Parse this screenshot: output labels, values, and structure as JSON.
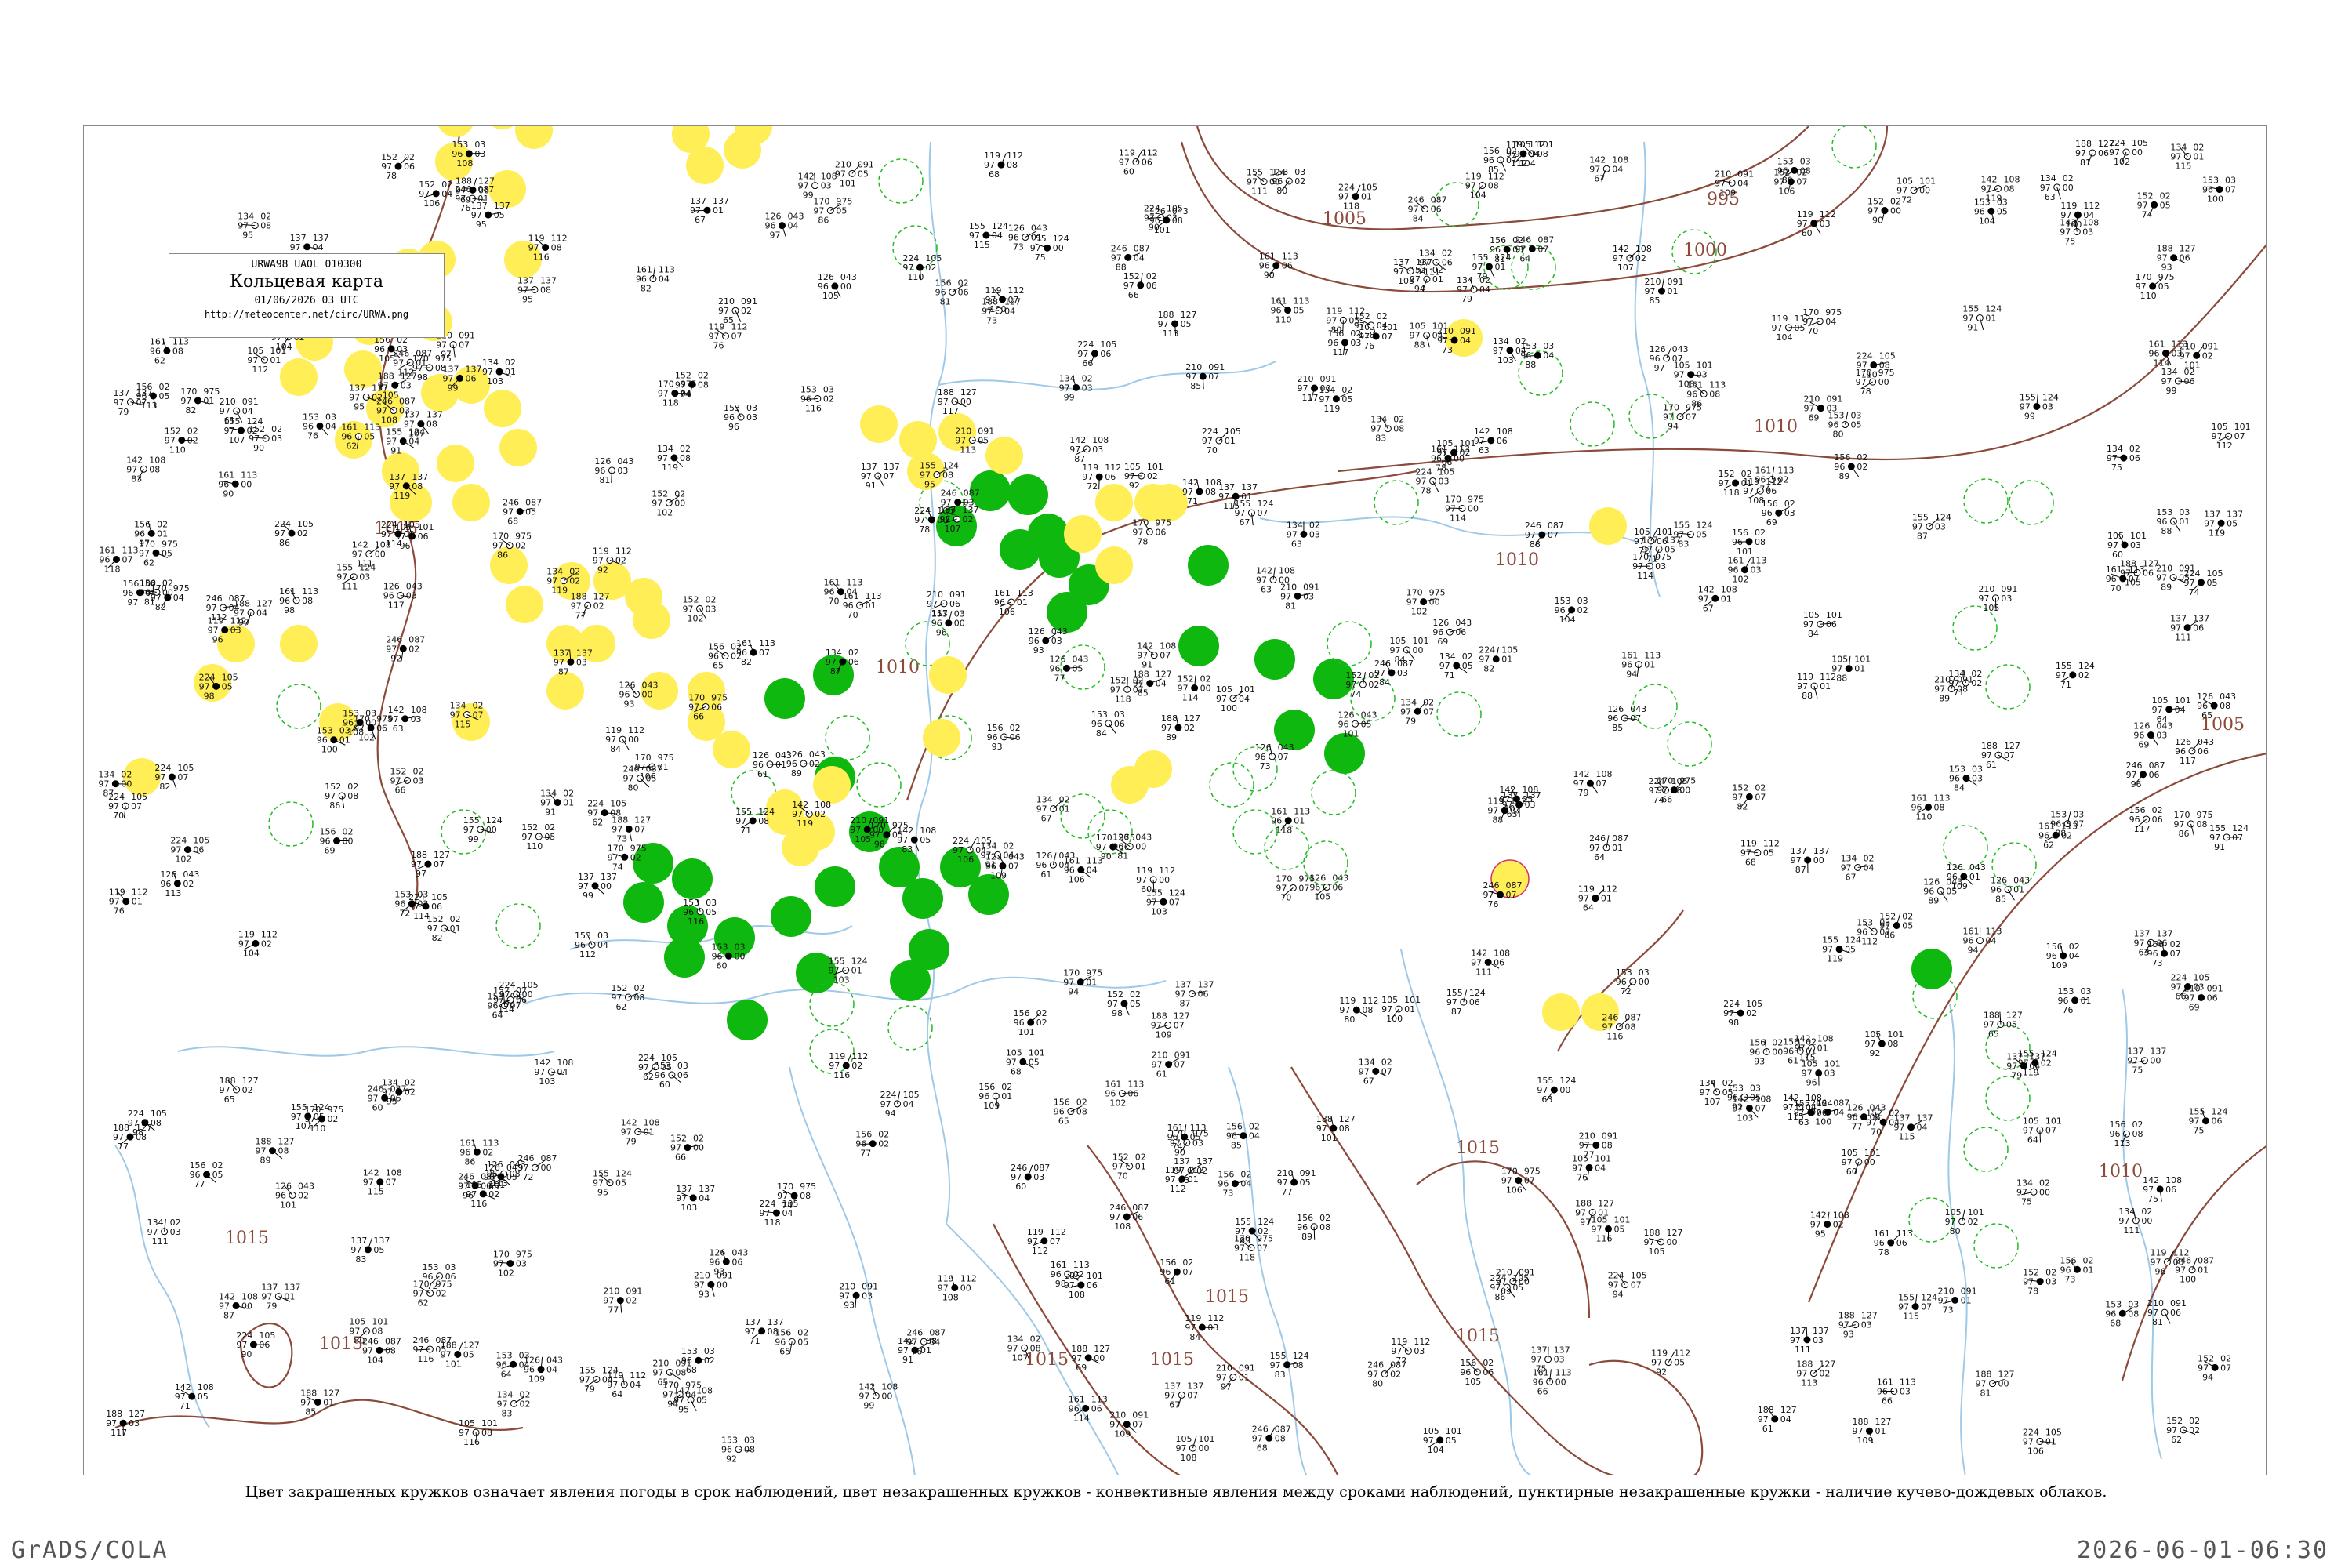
{
  "header": {
    "code_line": "URWA98  UAOL  010300",
    "title": "Кольцевая карта",
    "date_line": "01/06/2026 03 UTC",
    "url": "http://meteocenter.net/circ/URWA.png"
  },
  "caption": "Цвет закрашенных кружков означает явления погоды в срок наблюдений, цвет незакрашенных кружков - конвективные явления между сроками наблюдений, пунктирные незакрашенные кружки - наличие кучево-дождевых облаков.",
  "footer": {
    "left": "GrADS/COLA",
    "right": "2026-06-01-06:30"
  },
  "colors": {
    "isobar": "#8b4a3a",
    "water": "#9ec9e8",
    "rain_fill": "#0fb80f",
    "fog_fill": "#ffee55",
    "cb_ring": "#22bb22",
    "thunder_ring": "#d03070"
  },
  "isobars": [
    {
      "label": "995"
    },
    {
      "label": "1000"
    },
    {
      "label": "1005"
    },
    {
      "label": "1005"
    },
    {
      "label": "1010"
    },
    {
      "label": "1010"
    },
    {
      "label": "1010"
    },
    {
      "label": "1010"
    },
    {
      "label": "1015"
    },
    {
      "label": "1015"
    },
    {
      "label": "1015"
    },
    {
      "label": "1015"
    },
    {
      "label": "1015"
    },
    {
      "label": "1015"
    },
    {
      "label": "1015"
    },
    {
      "label": "1015"
    }
  ],
  "stations_sample": [
    {
      "t": "119",
      "p": "97",
      "d": "112"
    },
    {
      "t": "134",
      "p": "97",
      "d": "02"
    },
    {
      "t": "152",
      "p": "97",
      "d": "02"
    },
    {
      "t": "156",
      "p": "96",
      "d": "02"
    },
    {
      "t": "153",
      "p": "96",
      "d": "03"
    },
    {
      "t": "137",
      "p": "97",
      "d": "137"
    },
    {
      "t": "170",
      "p": "97",
      "d": "975"
    },
    {
      "t": "126",
      "p": "96",
      "d": "043"
    },
    {
      "t": "105",
      "p": "97",
      "d": "101"
    },
    {
      "t": "142",
      "p": "97",
      "d": "108"
    },
    {
      "t": "161",
      "p": "96",
      "d": "113"
    },
    {
      "t": "210",
      "p": "97",
      "d": "091"
    },
    {
      "t": "246",
      "p": "97",
      "d": "087"
    },
    {
      "t": "155",
      "p": "97",
      "d": "124"
    },
    {
      "t": "224",
      "p": "97",
      "d": "105"
    },
    {
      "t": "188",
      "p": "97",
      "d": "127"
    }
  ]
}
